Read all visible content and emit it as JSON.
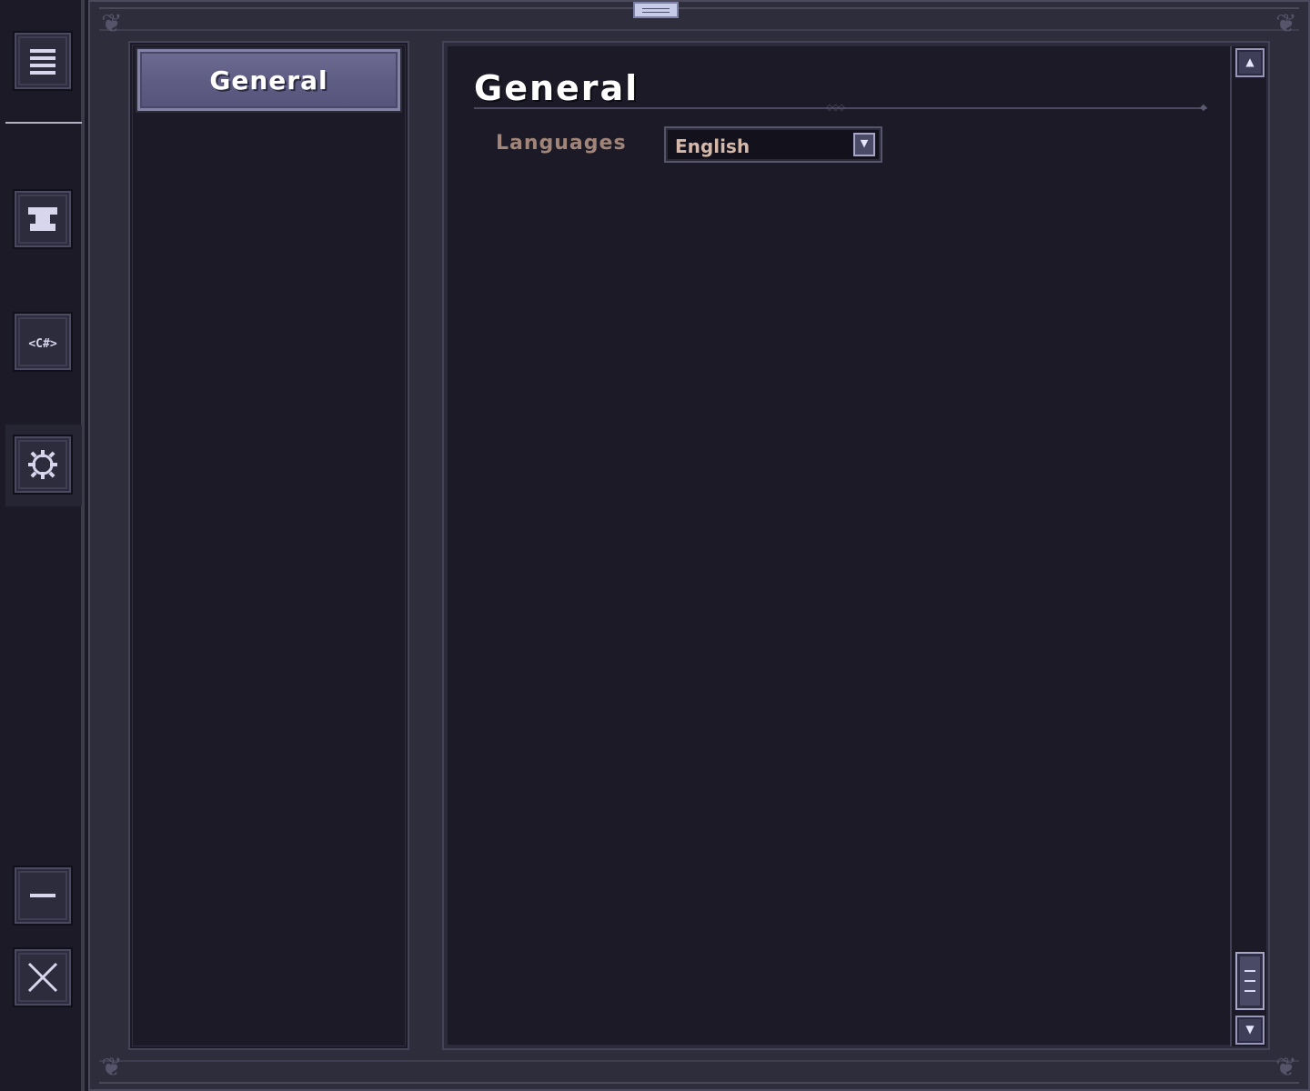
{
  "rail": {
    "items": [
      {
        "name": "menu-icon"
      },
      {
        "name": "anvil-icon"
      },
      {
        "name": "csharp-icon",
        "label": "<C#>"
      },
      {
        "name": "gear-icon"
      },
      {
        "name": "minimize-icon"
      },
      {
        "name": "close-icon"
      }
    ],
    "active_item": "gear-icon"
  },
  "sidebar": {
    "categories": [
      {
        "label": "General",
        "selected": true
      }
    ]
  },
  "main": {
    "title": "General",
    "settings": [
      {
        "label": "Languages",
        "value": "English"
      }
    ]
  },
  "colors": {
    "background": "#1b1a26",
    "frame": "#2e2d3b",
    "selected_button": "#6e6c92",
    "label_text": "#a08578",
    "dropdown_text": "#d6b8a8"
  }
}
